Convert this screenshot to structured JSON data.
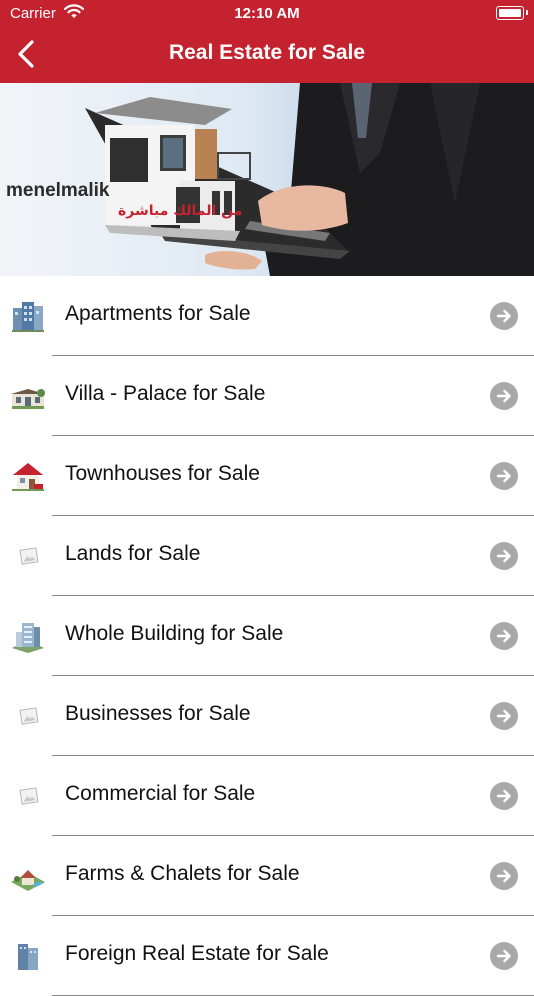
{
  "status_bar": {
    "carrier": "Carrier",
    "time": "12:10 AM"
  },
  "nav": {
    "title": "Real Estate for Sale",
    "back_icon": "chevron-left-icon"
  },
  "banner": {
    "brand_en": "menelmalik",
    "brand_ar": "من المالك مباشرة"
  },
  "colors": {
    "accent": "#c4222f",
    "arrow_circle": "#a9a9a9",
    "separator": "#8a8a8a"
  },
  "list": [
    {
      "label": "Apartments for Sale",
      "icon": "apartment-building-icon"
    },
    {
      "label": "Villa - Palace for Sale",
      "icon": "villa-icon"
    },
    {
      "label": "Townhouses for Sale",
      "icon": "townhouse-icon"
    },
    {
      "label": "Lands for Sale",
      "icon": "placeholder-image-icon"
    },
    {
      "label": "Whole Building for Sale",
      "icon": "whole-building-icon"
    },
    {
      "label": "Businesses for Sale",
      "icon": "placeholder-image-icon"
    },
    {
      "label": "Commercial for Sale",
      "icon": "placeholder-image-icon"
    },
    {
      "label": "Farms & Chalets for Sale",
      "icon": "farm-chalet-icon"
    },
    {
      "label": "Foreign Real Estate for Sale",
      "icon": "foreign-building-icon"
    }
  ]
}
